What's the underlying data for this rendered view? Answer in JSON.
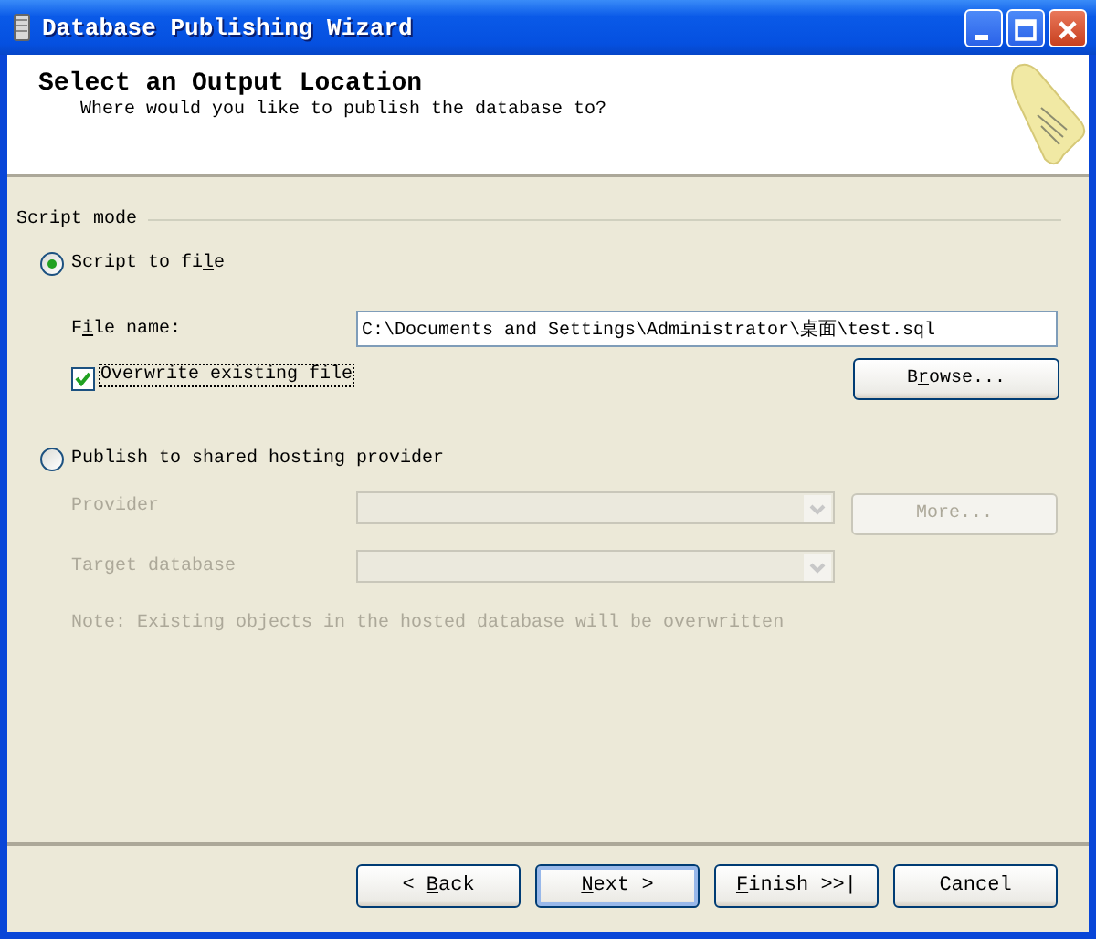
{
  "window": {
    "title": "Database Publishing Wizard"
  },
  "header": {
    "title": "Select an Output Location",
    "subtitle": "Where would you like to publish the database to?"
  },
  "group": {
    "label": "Script mode"
  },
  "modes": [
    {
      "label": [
        {
          "text": "Script to fi",
          "underlined": false
        },
        {
          "text": "l",
          "underlined": true
        },
        {
          "text": "e",
          "underlined": false
        }
      ],
      "selected": true
    },
    {
      "label": [
        {
          "text": "Publish to shared hosting provider",
          "underlined": false
        }
      ],
      "selected": false
    }
  ],
  "file_name": {
    "label": [
      {
        "text": "F",
        "underlined": false
      },
      {
        "text": "i",
        "underlined": true
      },
      {
        "text": "le name:",
        "underlined": false
      }
    ],
    "value": "C:\\Documents and Settings\\Administrator\\桌面\\test.sql"
  },
  "overwrite": {
    "label": "Overwrite existing file",
    "checked": true
  },
  "browse_button": {
    "label": [
      {
        "text": "B",
        "underlined": false
      },
      {
        "text": "r",
        "underlined": true
      },
      {
        "text": "owse...",
        "underlined": false
      }
    ]
  },
  "provider": {
    "label": "Provider",
    "disabled": true
  },
  "more_button": {
    "label": "More...",
    "disabled": true
  },
  "target_database": {
    "label": "Target database",
    "disabled": true
  },
  "note": {
    "text": "Note: Existing objects in the hosted database will be overwritten",
    "disabled": true
  },
  "buttons": [
    {
      "label": [
        {
          "text": "< ",
          "underlined": false
        },
        {
          "text": "B",
          "underlined": true
        },
        {
          "text": "ack",
          "underlined": false
        }
      ],
      "default": false
    },
    {
      "label": [
        {
          "text": "N",
          "underlined": true
        },
        {
          "text": "ext >",
          "underlined": false
        }
      ],
      "default": true
    },
    {
      "label": [
        {
          "text": "F",
          "underlined": true
        },
        {
          "text": "inish >>|",
          "underlined": false
        }
      ],
      "default": false
    },
    {
      "label": [
        {
          "text": "Cancel",
          "underlined": false
        }
      ],
      "default": false
    }
  ]
}
